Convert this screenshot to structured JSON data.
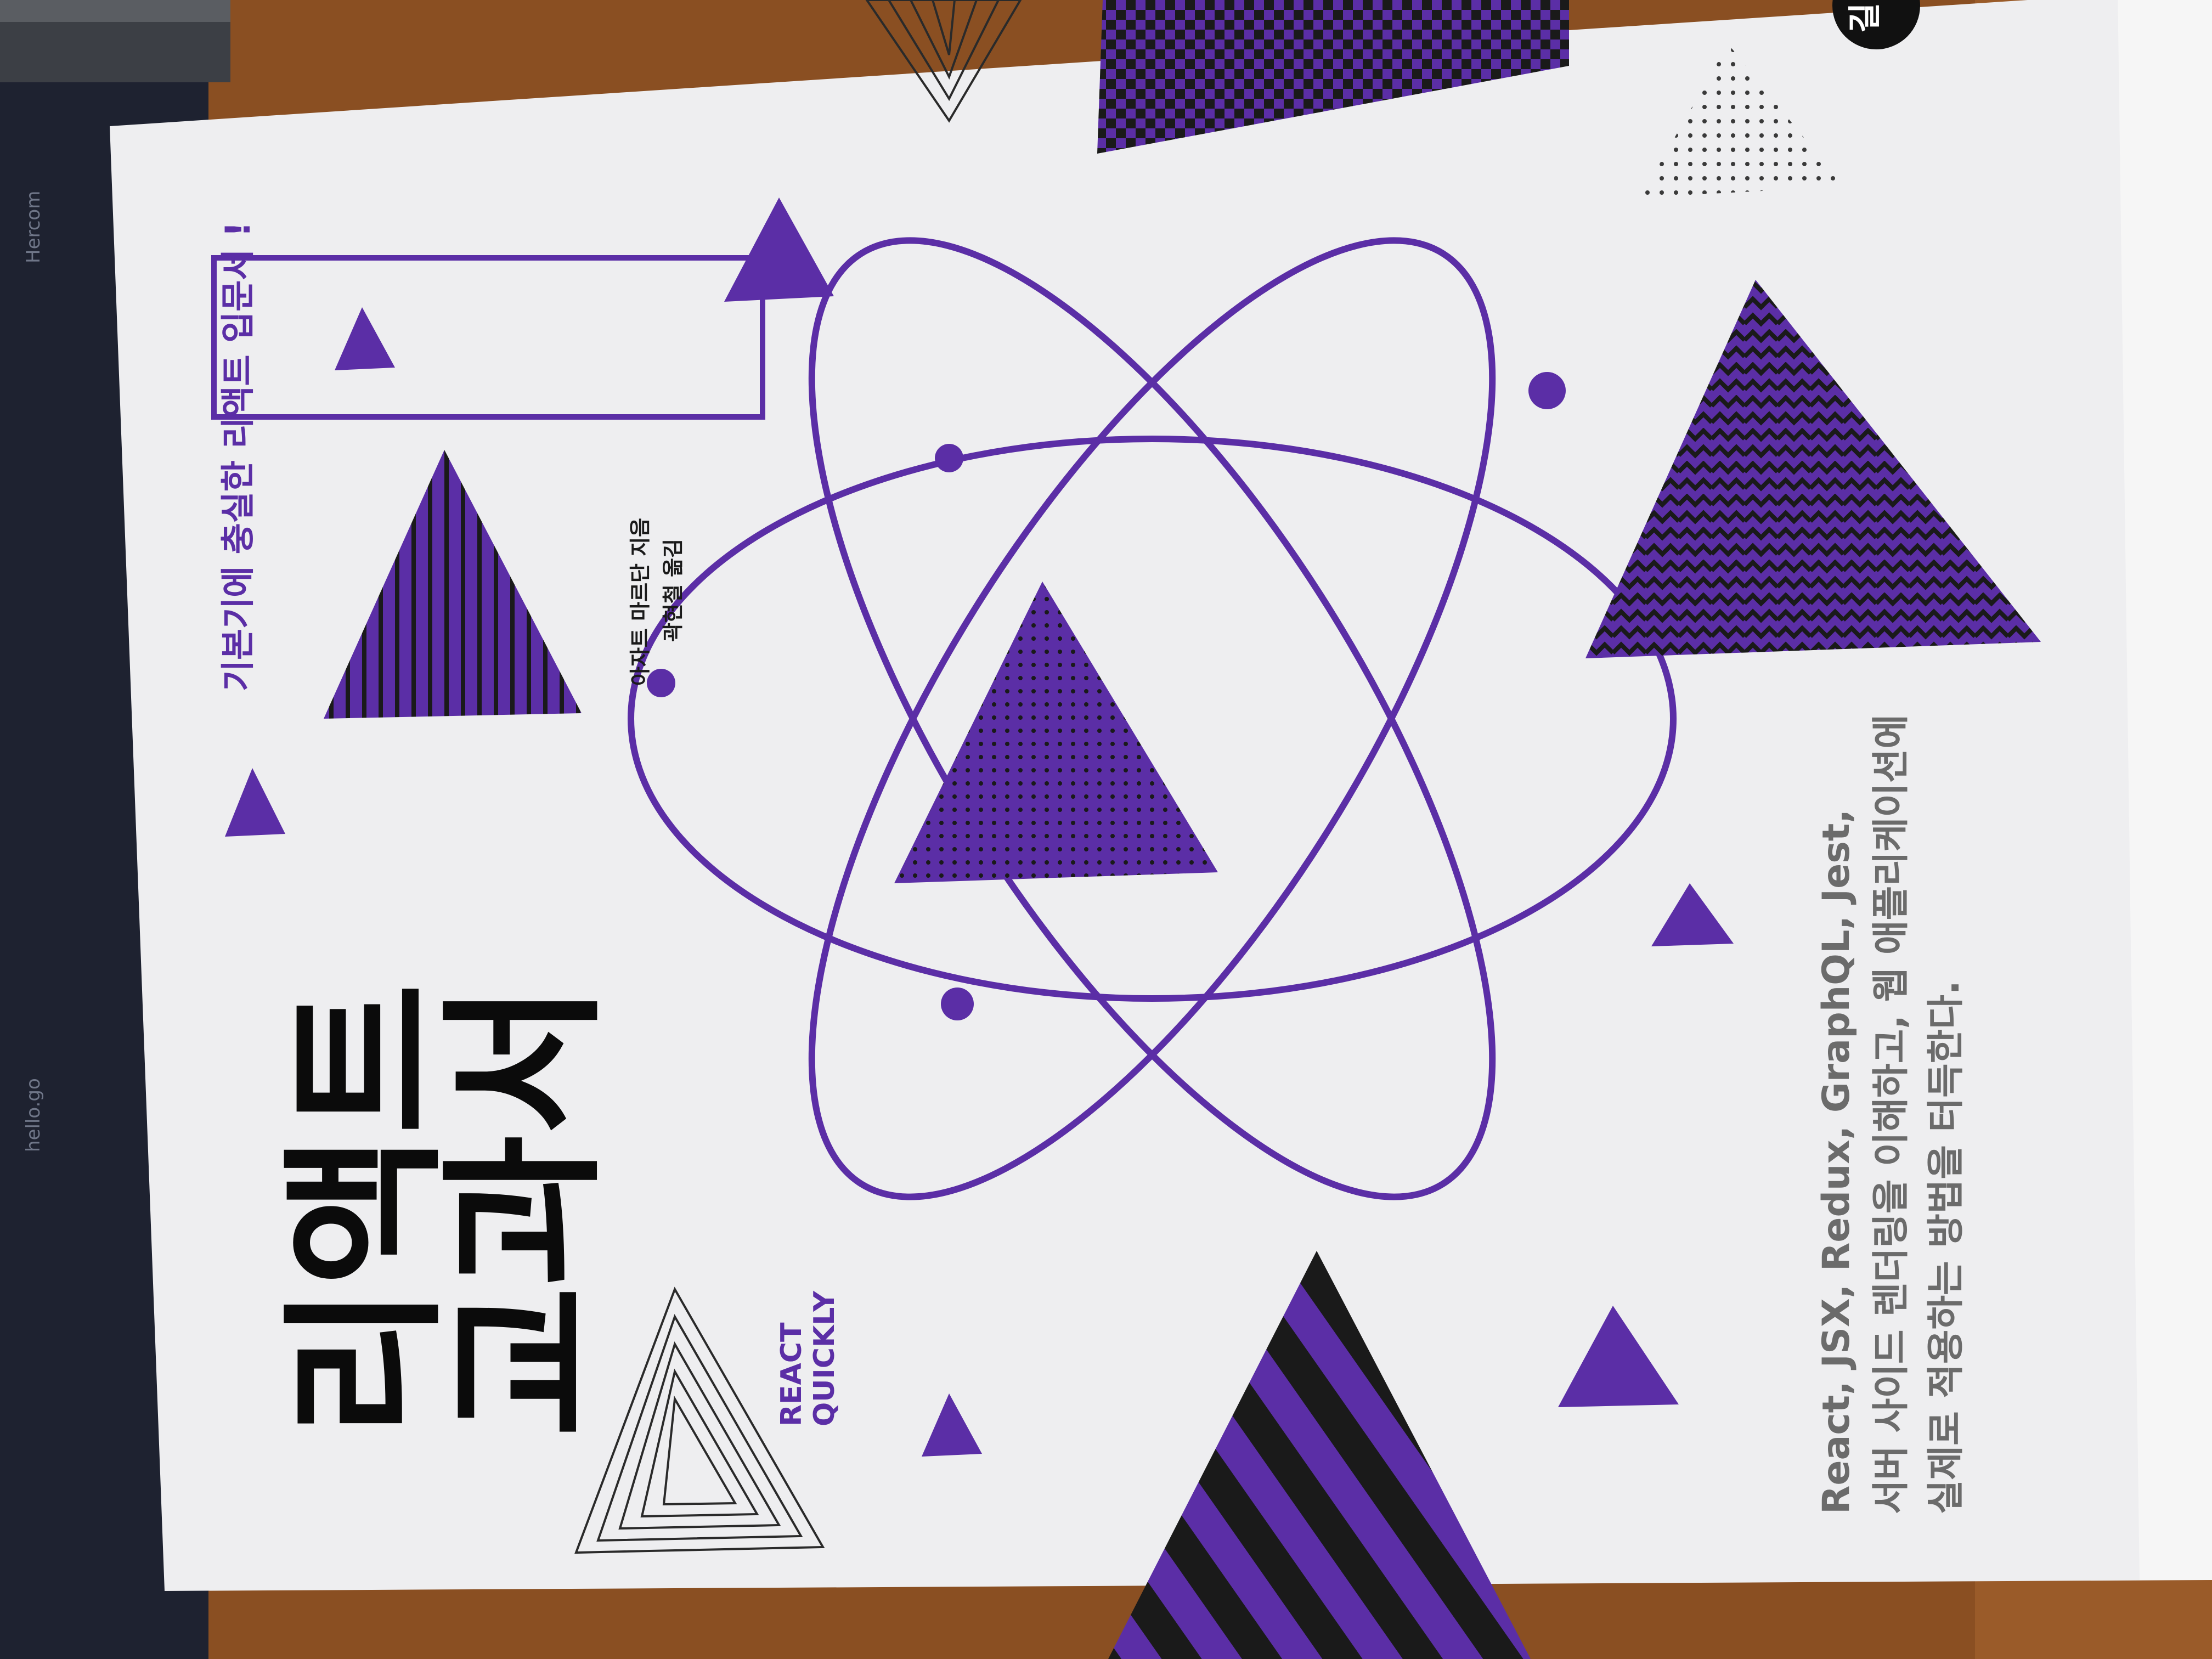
{
  "book": {
    "title_line1": "리액트",
    "title_line2": "교과서",
    "english_title_line1": "REACT",
    "english_title_line2": "QUICKLY",
    "tagline": "기본기에 충실한 리액트 입문서 !",
    "author": "아자트 마르단 지음",
    "translator": "곽현철 옮김",
    "blurb_line1": "React, JSX, Redux, GraphQL, Jest,",
    "blurb_line2": "서버 사이드 렌더링을 이해하고, 웹 애플리케이션에",
    "blurb_line3": "실제로 적용하는 방법을 터득한다.",
    "publisher_mark": "길"
  },
  "background_screen": {
    "line1": "hello.go",
    "line2": "Hercom"
  },
  "colors": {
    "cover": "#eeeef0",
    "accent": "#5b2ea6",
    "title": "#0b0b0b",
    "blurb": "#6b6b6b",
    "desk": "#8a4f22",
    "laptop": "#1e2230"
  }
}
